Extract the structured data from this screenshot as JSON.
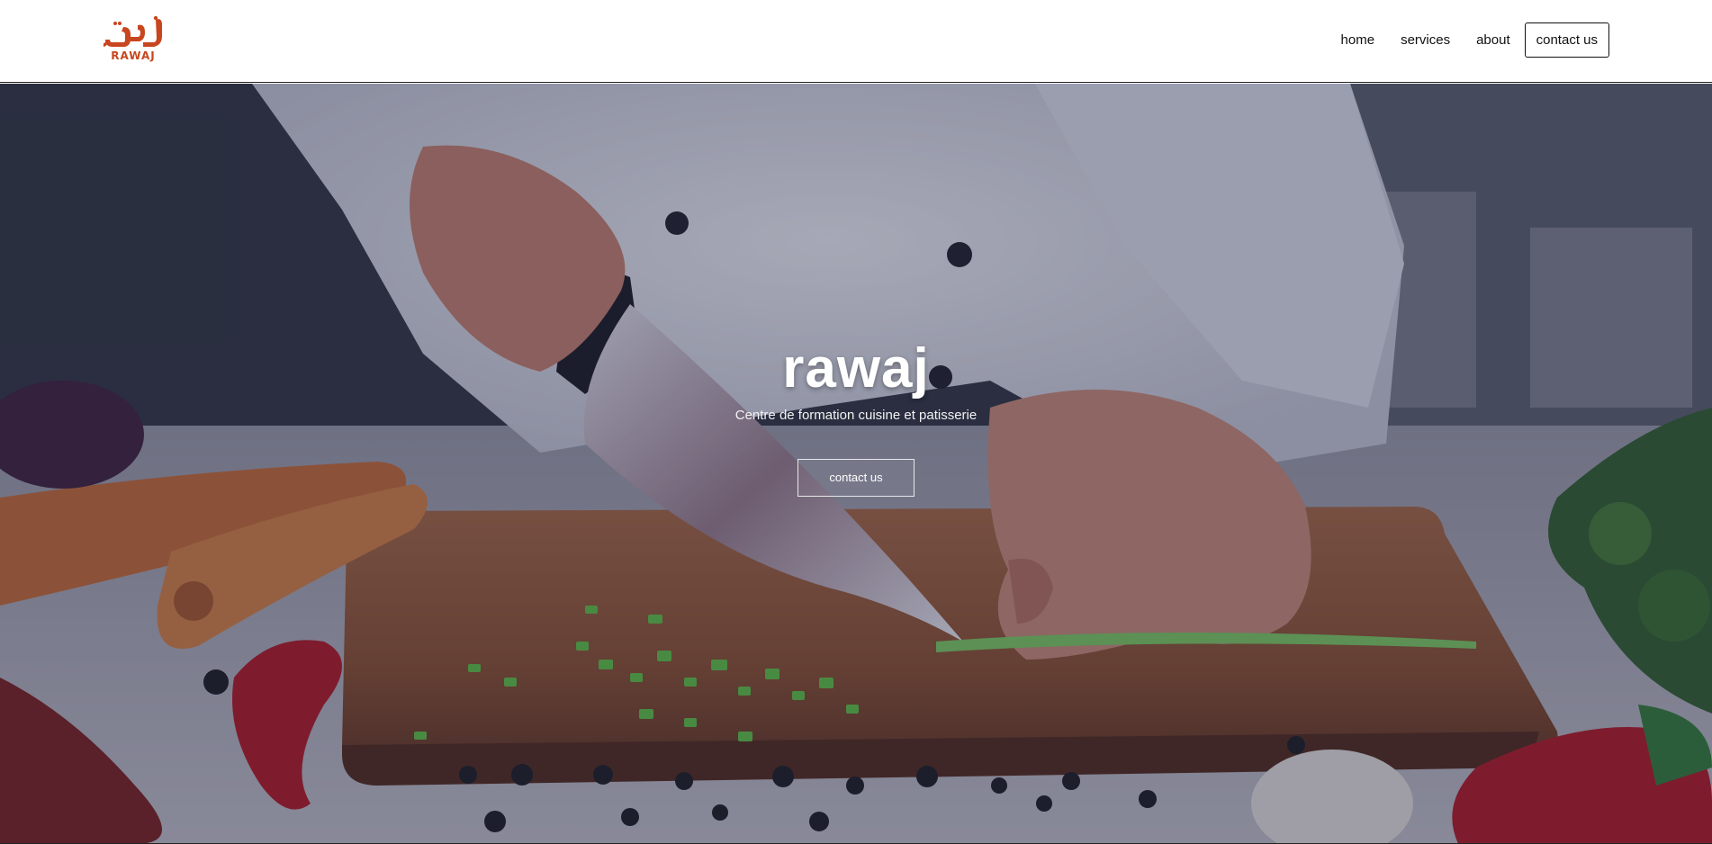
{
  "brand": {
    "logo_latin": "RAWAJ",
    "logo_arabic": "رواج",
    "logo_color": "#c8461f"
  },
  "nav": {
    "items": [
      {
        "label": "home"
      },
      {
        "label": "services"
      },
      {
        "label": "about"
      }
    ],
    "cta_label": "contact us"
  },
  "hero": {
    "title": "rawaj",
    "subtitle": "Centre de formation cuisine et patisserie",
    "button_label": "contact us",
    "background_image": "chef-cutting-vegetables-on-board"
  }
}
